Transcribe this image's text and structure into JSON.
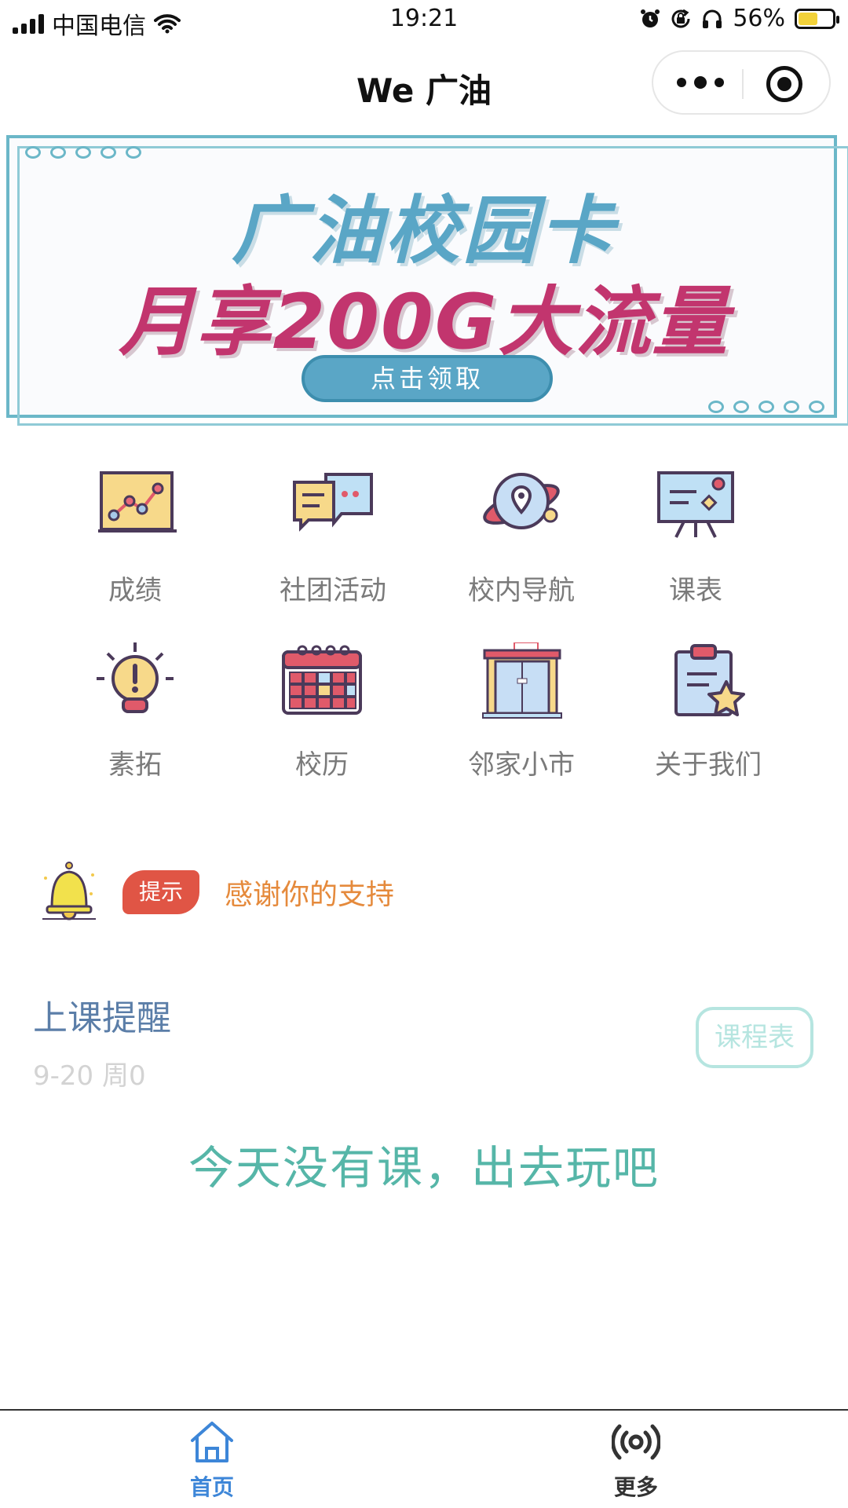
{
  "status_bar": {
    "carrier": "中国电信",
    "time": "19:21",
    "battery_text": "56%",
    "battery_level": 0.56,
    "icons": [
      "signal-icon",
      "wifi-icon",
      "alarm-icon",
      "rotation-lock-icon",
      "headphones-icon",
      "battery-charging-icon"
    ]
  },
  "nav": {
    "title": "We 广油",
    "more_icon": "more-dots-icon",
    "close_icon": "capsule-home-icon"
  },
  "banner": {
    "line1": "广油校园卡",
    "line2": "月享200G大流量",
    "button_label": "点击领取",
    "colors": {
      "blue": "#5aa6c6",
      "pink": "#c2356e"
    }
  },
  "menu": {
    "items": [
      {
        "label": "成绩",
        "icon": "grade-chart-icon"
      },
      {
        "label": "社团活动",
        "icon": "chat-bubbles-icon"
      },
      {
        "label": "校内导航",
        "icon": "planet-location-icon"
      },
      {
        "label": "课表",
        "icon": "presentation-board-icon"
      },
      {
        "label": "素拓",
        "icon": "lightbulb-icon"
      },
      {
        "label": "校历",
        "icon": "calendar-icon"
      },
      {
        "label": "邻家小市",
        "icon": "shop-icon"
      },
      {
        "label": "关于我们",
        "icon": "clipboard-star-icon"
      }
    ]
  },
  "notice": {
    "tag": "提示",
    "text": "感谢你的支持",
    "icon": "bell-icon"
  },
  "reminder": {
    "title": "上课提醒",
    "date": "9-20 周0",
    "schedule_button": "课程表",
    "empty_message": "今天没有课，出去玩吧"
  },
  "tab_bar": {
    "tabs": [
      {
        "label": "首页",
        "icon": "home-icon",
        "color": "#3d86d8"
      },
      {
        "label": "更多",
        "icon": "broadcast-icon",
        "color": "#333333"
      }
    ]
  }
}
